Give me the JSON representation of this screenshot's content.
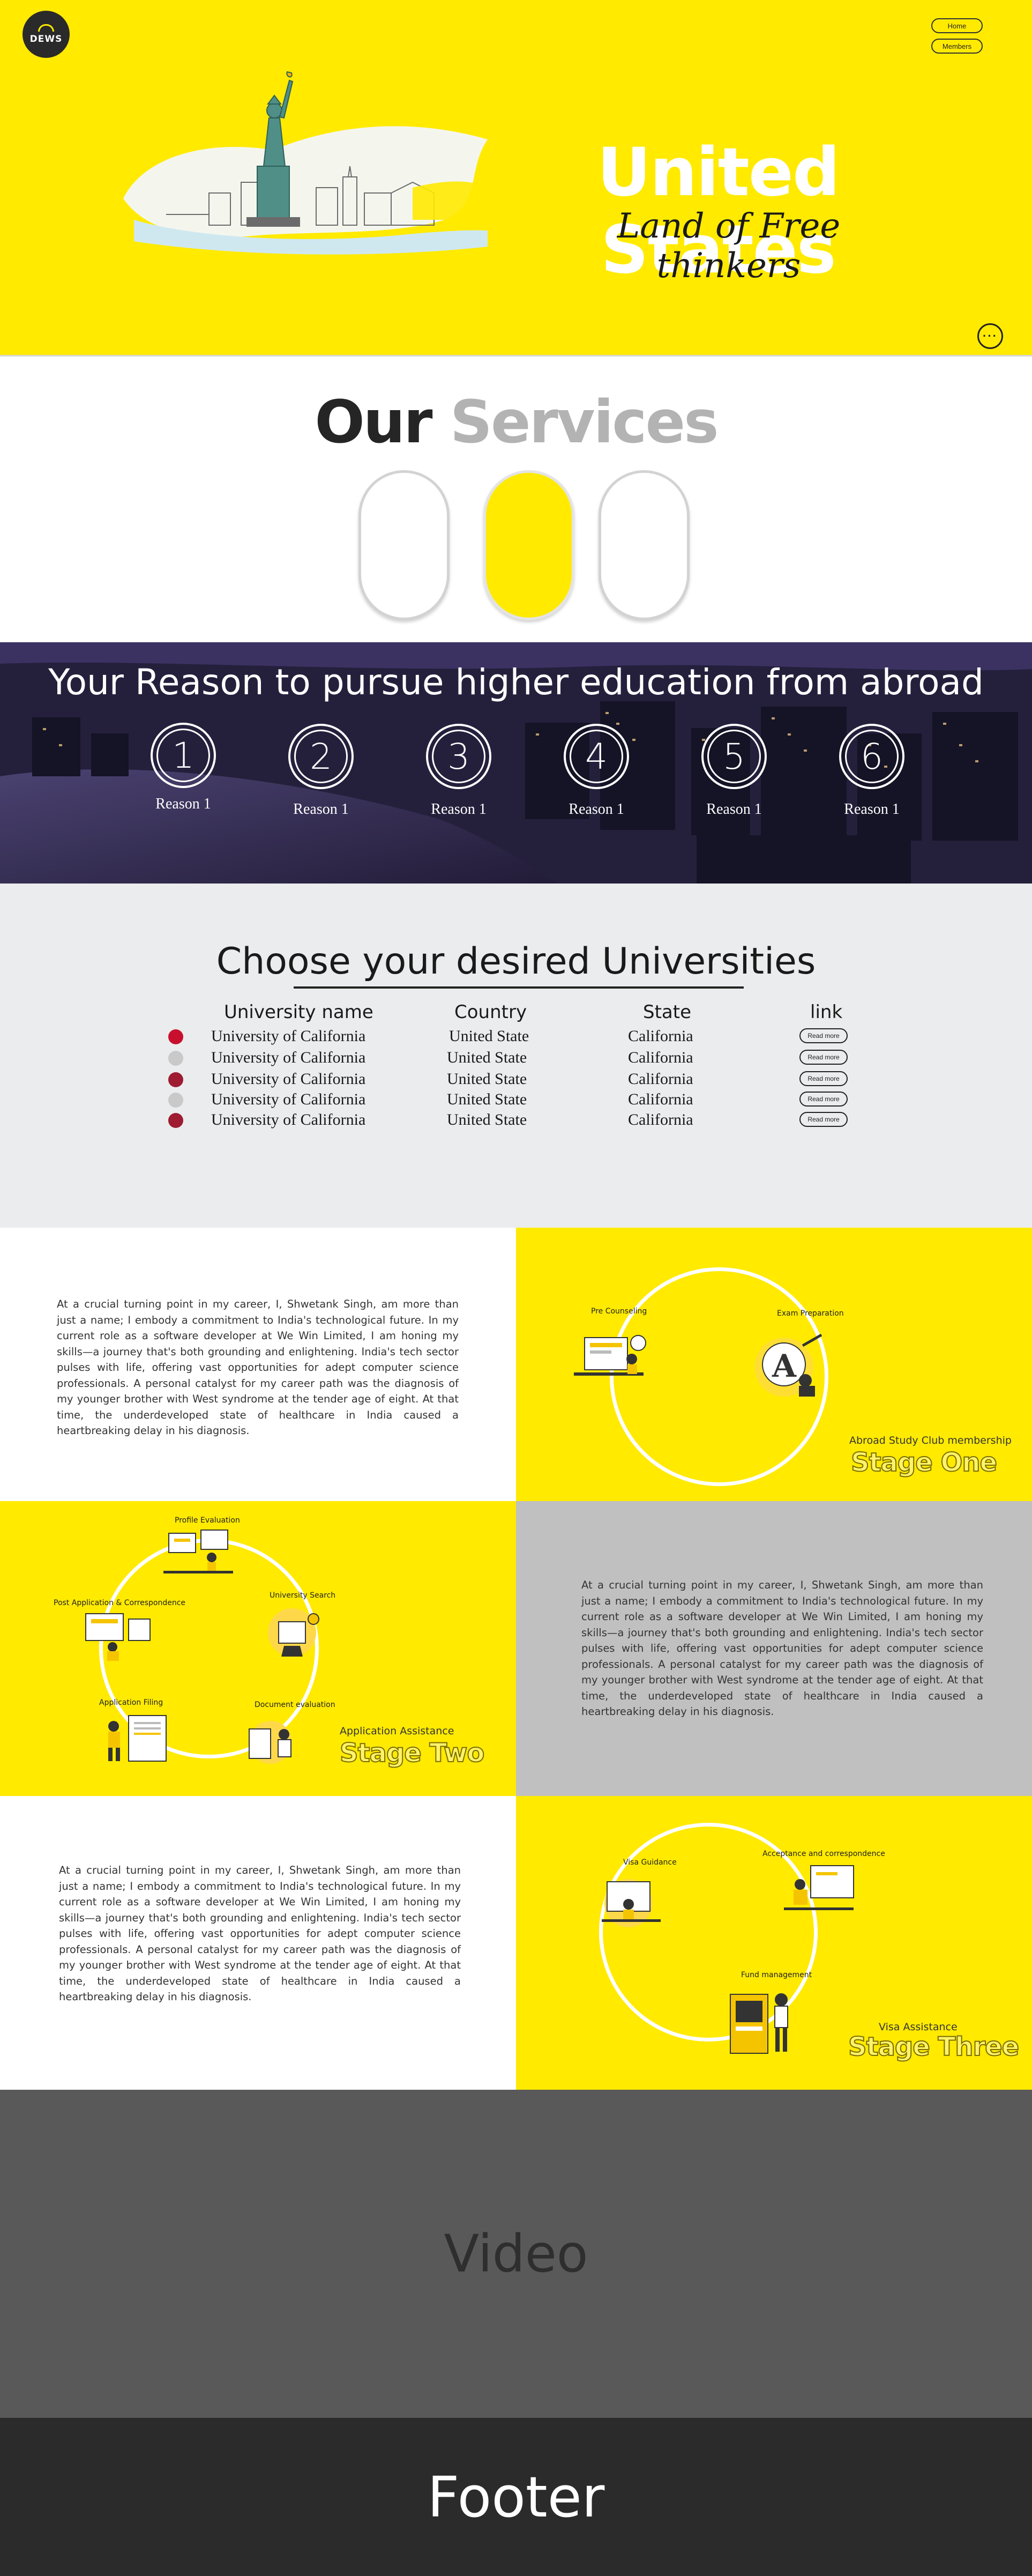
{
  "brand": {
    "logo_text": "DEWS"
  },
  "nav": {
    "home": "Home",
    "members": "Members"
  },
  "hero": {
    "title": "United States",
    "subtitle": "Land of Free thinkers"
  },
  "services": {
    "title_a": "Our",
    "title_b": "Services"
  },
  "reasons": {
    "title": "Your Reason to pursue higher education from abroad",
    "items": [
      {
        "number": "1",
        "label": "Reason 1"
      },
      {
        "number": "2",
        "label": "Reason 1"
      },
      {
        "number": "3",
        "label": "Reason 1"
      },
      {
        "number": "4",
        "label": "Reason 1"
      },
      {
        "number": "5",
        "label": "Reason 1"
      },
      {
        "number": "6",
        "label": "Reason 1"
      }
    ]
  },
  "universities": {
    "title": "Choose your desired Universities",
    "headers": {
      "name": "University name",
      "country": "Country",
      "state": "State",
      "link": "link"
    },
    "rows": [
      {
        "name": "University of California",
        "country": "United State",
        "state": "California",
        "link": "Read more",
        "icon_color": "#c8102e"
      },
      {
        "name": "University of California",
        "country": "United State",
        "state": "California",
        "link": "Read more",
        "icon_color": "#c9c9c9"
      },
      {
        "name": "University of California",
        "country": "United State",
        "state": "California",
        "link": "Read more",
        "icon_color": "#9e1b32"
      },
      {
        "name": "University of California",
        "country": "United State",
        "state": "California",
        "link": "Read more",
        "icon_color": "#c9c9c9"
      },
      {
        "name": "University of California",
        "country": "United State",
        "state": "California",
        "link": "Read more",
        "icon_color": "#9e1b32"
      }
    ]
  },
  "stage_text": "At a crucial turning point in my career, I, Shwetank Singh, am more than just a name; I embody a commitment to India's technological future. In my current role as a software developer at We Win Limited, I am honing my skills—a journey that's both grounding and enlightening. India's tech sector pulses with life, offering vast opportunities for adept computer science professionals. A personal catalyst for my career path was the diagnosis of my younger brother with West syndrome at the tender age of eight. At that time, the underdeveloped state of healthcare in India caused a heartbreaking delay in his diagnosis.",
  "stage_one": {
    "name": "Abroad Study Club membership",
    "label": "Stage One",
    "captions": {
      "a": "Pre Counseling",
      "b": "Exam Preparation"
    }
  },
  "stage_two": {
    "name": "Application Assistance",
    "label": "Stage Two",
    "captions": {
      "a": "Profile Evaluation",
      "b": "University Search",
      "c": "Post Application & Correspondence",
      "d": "Application Filing",
      "e": "Document evaluation"
    }
  },
  "stage_three": {
    "name": "Visa Assistance",
    "label": "Stage Three",
    "captions": {
      "a": "Visa Guidance",
      "b": "Acceptance and correspondence",
      "c": "Fund management"
    }
  },
  "video": {
    "label": "Video"
  },
  "footer": {
    "label": "Footer"
  },
  "colors": {
    "accent": "#ffea00",
    "dark": "#2b2b2b",
    "gray": "#c0c0c0"
  }
}
